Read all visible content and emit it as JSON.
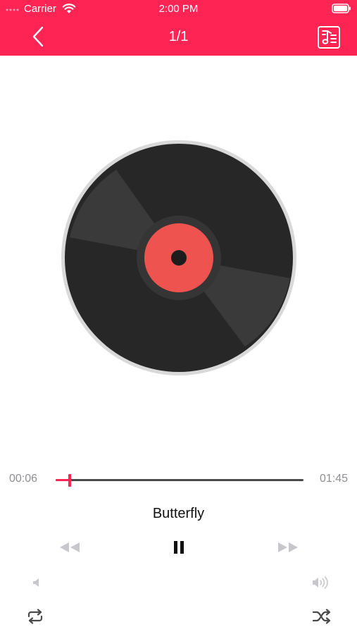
{
  "status_bar": {
    "carrier": "Carrier",
    "time": "2:00 PM"
  },
  "nav": {
    "title": "1/1",
    "back_icon": "chevron-left-icon",
    "playlist_icon": "music-list-icon"
  },
  "player": {
    "song_title": "Butterfly",
    "elapsed": "00:06",
    "total": "01:45",
    "progress": 0.057
  },
  "controls": {
    "prev_icon": "rewind-icon",
    "pause_icon": "pause-icon",
    "next_icon": "fast-forward-icon",
    "volume_down_icon": "volume-down-icon",
    "volume_up_icon": "volume-up-icon",
    "repeat_icon": "repeat-icon",
    "shuffle_icon": "shuffle-icon"
  },
  "colors": {
    "accent": "#fe2555",
    "record_body": "#272727",
    "record_label": "#ef5350"
  }
}
